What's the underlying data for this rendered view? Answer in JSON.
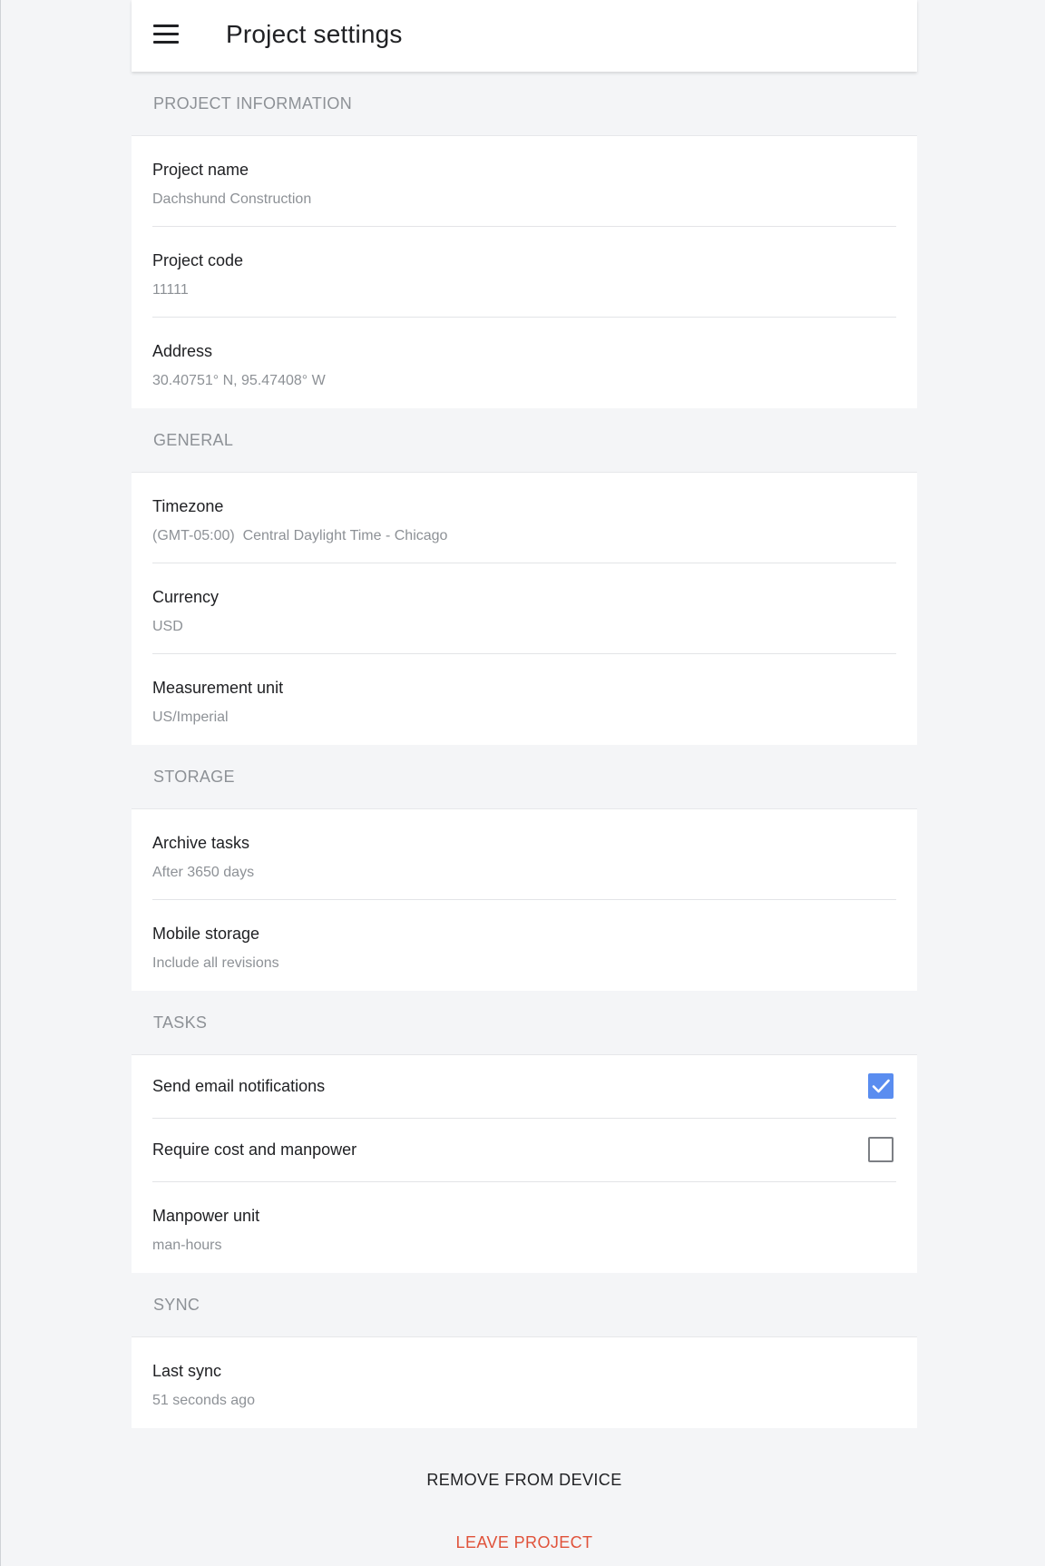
{
  "app_bar": {
    "title": "Project settings",
    "menu_icon": "hamburger-menu-icon"
  },
  "sections": {
    "project_information": {
      "header": "PROJECT INFORMATION",
      "rows": [
        {
          "label": "Project name",
          "value": "Dachshund Construction"
        },
        {
          "label": "Project code",
          "value": "11111"
        },
        {
          "label": "Address",
          "value": "30.40751° N, 95.47408° W"
        }
      ]
    },
    "general": {
      "header": "GENERAL",
      "rows": [
        {
          "label": "Timezone",
          "value": "(GMT-05:00)  Central Daylight Time - Chicago"
        },
        {
          "label": "Currency",
          "value": "USD"
        },
        {
          "label": "Measurement unit",
          "value": "US/Imperial"
        }
      ]
    },
    "storage": {
      "header": "STORAGE",
      "rows": [
        {
          "label": "Archive tasks",
          "value": "After 3650 days"
        },
        {
          "label": "Mobile storage",
          "value": "Include all revisions"
        }
      ]
    },
    "tasks": {
      "header": "TASKS",
      "send_email": {
        "label": "Send email notifications",
        "checked": true
      },
      "require_cost": {
        "label": "Require cost and manpower",
        "checked": false
      },
      "manpower_unit": {
        "label": "Manpower unit",
        "value": "man-hours"
      }
    },
    "sync": {
      "header": "SYNC",
      "rows": [
        {
          "label": "Last sync",
          "value": "51 seconds ago"
        }
      ]
    }
  },
  "actions": {
    "remove_label": "REMOVE FROM DEVICE",
    "leave_label": "LEAVE PROJECT"
  },
  "colors": {
    "accent_checkbox": "#5a8df0",
    "danger": "#e0523a",
    "background": "#f4f5f7",
    "secondary_text": "#8d9196"
  }
}
